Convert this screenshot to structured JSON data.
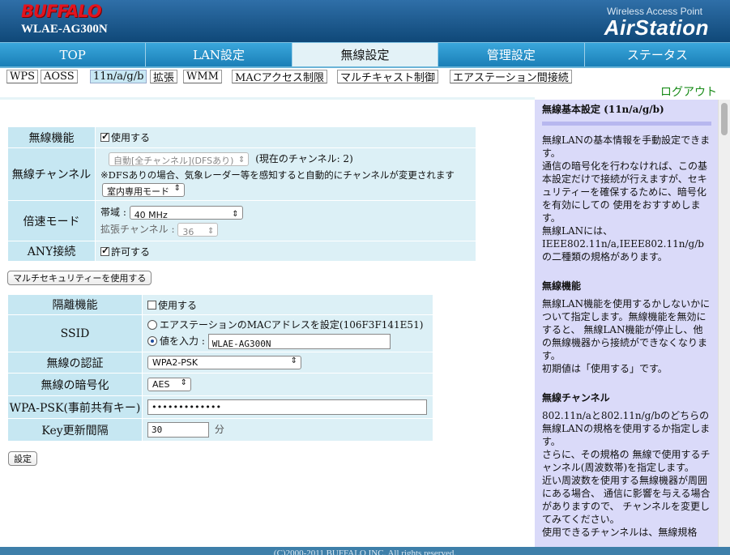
{
  "header": {
    "brand": "BUFFALO",
    "model": "WLAE-AG300N",
    "product_line": "Wireless Access Point",
    "product_logo": "AirStation"
  },
  "main_tabs": [
    "TOP",
    "LAN設定",
    "無線設定",
    "管理設定",
    "ステータス"
  ],
  "active_main_tab": "無線設定",
  "sub_tabs": [
    "WPS",
    "AOSS",
    "11n/a/g/b",
    "拡張",
    "WMM",
    "MACアクセス制限",
    "マルチキャスト制御",
    "エアステーション間接続"
  ],
  "active_sub_tab": "11n/a/g/b",
  "logout": "ログアウト",
  "basic": {
    "wireless_function": {
      "label": "無線機能",
      "checkbox_label": "使用する",
      "checked": true
    },
    "channel": {
      "label": "無線チャンネル",
      "select_value": "自動[全チャンネル](DFSあり)",
      "current": "(現在のチャンネル: 2)",
      "note": "※DFSありの場合、気象レーダー等を感知すると自動的にチャンネルが変更されます",
      "mode_value": "室内専用モード"
    },
    "speed_mode": {
      "label": "倍速モード",
      "band_label": "帯域 :",
      "band_value": "40 MHz",
      "ext_label": "拡張チャンネル :",
      "ext_value": "36"
    },
    "any": {
      "label": "ANY接続",
      "checkbox_label": "許可する",
      "checked": true
    }
  },
  "multi_security_button": "マルチセキュリティーを使用する",
  "security": {
    "isolation": {
      "label": "隔離機能",
      "checkbox_label": "使用する",
      "checked": false
    },
    "ssid": {
      "label": "SSID",
      "option_mac": "エアステーションのMACアドレスを設定(106F3F141E51)",
      "option_input": "値を入力 :",
      "value": "WLAE-AG300N"
    },
    "auth": {
      "label": "無線の認証",
      "value": "WPA2-PSK"
    },
    "encryption": {
      "label": "無線の暗号化",
      "value": "AES"
    },
    "psk": {
      "label": "WPA-PSK(事前共有キー)",
      "value": "•••••••••••••"
    },
    "key_interval": {
      "label": "Key更新間隔",
      "value": "30",
      "unit": "分"
    }
  },
  "submit_button": "設定",
  "help": {
    "title": "無線基本設定 (11n/a/g/b)",
    "intro": "無線LANの基本情報を手動設定できます。\n通信の暗号化を行わなければ、この基本設定だけで接続が行えますが、セキュリティーを確保するために、暗号化を有効にしての 使用をおすすめします。\n無線LANには、\nIEEE802.11n/a,IEEE802.11n/g/b の二種類の規格があります。",
    "sec1_title": "無線機能",
    "sec1_body": "無線LAN機能を使用するかしないかについて指定します。無線機能を無効にすると、 無線LAN機能が停止し、他の無線機器から接続ができなくなります。\n初期値は「使用する」です。",
    "sec2_title": "無線チャンネル",
    "sec2_body": "802.11n/aと802.11n/g/bのどちらの無線LANの規格を使用するか指定します。\nさらに、その規格の 無線で使用するチャンネル(周波数帯)を指定します。\n近い周波数を使用する無線機器が周囲にある場合、 通信に影響を与える場合がありますので、 チャンネルを変更してみてください。\n使用できるチャンネルは、無線規格"
  },
  "footer": "(C)2000-2011 BUFFALO INC. All rights reserved."
}
